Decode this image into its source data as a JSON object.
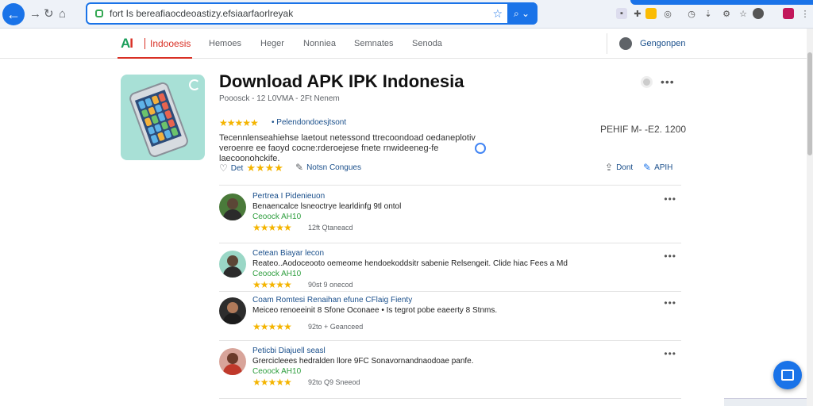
{
  "browser": {
    "url": "fort  Is  bereafiaocdeoastizy.efsiaarfaorlreyak",
    "back_icon": "arrow-left",
    "forward_icon": "arrow-right",
    "reload_icon": "reload",
    "home_icon": "home"
  },
  "site": {
    "logo_a": "A",
    "logo_i": "I",
    "brand": "Indooesis",
    "nav": [
      "Hemoes",
      "Heger",
      "Nonniea",
      "Semnates",
      "Senoda"
    ],
    "user_name": "Gengonpen"
  },
  "app": {
    "title": "Download APK IPK Indonesia",
    "meta": "Pooosck - 12 L0VMA - 2Ft  Nenem",
    "rating_stars": "★★★★★",
    "rating_link": "• Pelendondoesjtsont",
    "price": "PEHIF M- -E2. 1200",
    "description": "Tecennlenseahiehse laetout  netessond ttrecoondoad oedaneplotiv veroenre ee faoyd cocne:rderoejese fnete rnwideeneg-fe laecoonohckife.",
    "actions": {
      "save_label": "Det",
      "stars": "★★★★",
      "edit_label": "Notsn Congues",
      "share_label": "Dont",
      "apk_label": "APIH"
    }
  },
  "reviews": [
    {
      "name": "Pertrea I Pidenieuon",
      "text": "Benaencalce lsneoctrye learldinfg 9tl ontol",
      "sub": "Ceoock AH10",
      "stars": "★★★★★",
      "when": "12ft  Qtaneacd",
      "avatar_bg": "#4a7a3a"
    },
    {
      "name": "Cetean Biayar lecon",
      "text": "Reateo..Aodoceooto oemeome hendoekoddsitr sabenie Relsengeit. Clide hiac Fees  a Md",
      "sub": "Ceoock AH10",
      "stars": "★★★★★",
      "when": "90st  9 onecod",
      "avatar_bg": "#9ad7c6"
    },
    {
      "name": "Coam Romtesi Renaihan efune CFlaig Fienty",
      "text": "Meiceo renoeeinit  8 Sfone Oconaee • Is  tegrot pobe eaeerty 8 Stnms.",
      "sub": "",
      "stars": "★★★★★",
      "when": "92to  + Geanceed",
      "avatar_bg": "#2d2d2d"
    },
    {
      "name": "Peticbi Diajuell seasl",
      "text": "Grercicleees hedralden llore 9FC  Sonavornandnaodoae panfe.",
      "sub": "Ceoock AH10",
      "stars": "★★★★★",
      "when": "92to  Q9 Sneeod",
      "avatar_bg": "#d8a49a"
    }
  ],
  "colors": {
    "accent": "#1a73e8",
    "brand": "#d93025",
    "link": "#1a4f8b",
    "star": "#f4b400",
    "green": "#2e9e3e"
  }
}
